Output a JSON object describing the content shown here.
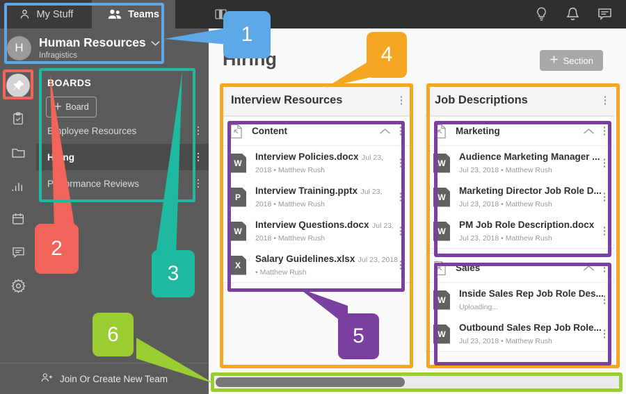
{
  "window": {
    "title": "Hiring"
  },
  "left_panel": {
    "tabs": [
      {
        "label": "My Stuff",
        "icon": "person-icon",
        "active": false
      },
      {
        "label": "Teams",
        "icon": "people-icon",
        "active": true
      }
    ],
    "team": {
      "avatar_initial": "H",
      "name": "Human Resources",
      "org": "Infragistics",
      "chevron": "chevron-down-icon"
    },
    "rail_icons": [
      "pin-icon",
      "checklist-icon",
      "folder-icon",
      "bar-chart-icon",
      "calendar-icon",
      "chat-icon",
      "settings-gear-icon"
    ],
    "boards": {
      "heading": "BOARDS",
      "add_board_label": "Board",
      "items": [
        {
          "label": "Employee Resources",
          "selected": false
        },
        {
          "label": "Hiring",
          "selected": true
        },
        {
          "label": "Performance Reviews",
          "selected": false
        }
      ]
    },
    "footer": {
      "label": "Join Or Create New Team",
      "icon": "add-people-icon"
    }
  },
  "topbar": {
    "panel_toggle_icon": "panel-toggle-icon",
    "icons": [
      "lightbulb-icon",
      "bell-icon",
      "chat-icon"
    ]
  },
  "main": {
    "page_title": "Hiring",
    "add_section_label": "Section",
    "columns": [
      {
        "title": "Interview Resources",
        "groups": [
          {
            "name": "Content",
            "collapsed": false,
            "files": [
              {
                "name": "Interview Policies.docx",
                "sub": "Jul 23, 2018 • Matthew Rush",
                "type": "W"
              },
              {
                "name": "Interview Training.pptx",
                "sub": "Jul 23, 2018 • Matthew Rush",
                "type": "P"
              },
              {
                "name": "Interview Questions.docx",
                "sub": "Jul 23, 2018 • Matthew Rush",
                "type": "W"
              },
              {
                "name": "Salary Guidelines.xlsx",
                "sub": "Jul 23, 2018 • Matthew Rush",
                "type": "X"
              }
            ]
          }
        ]
      },
      {
        "title": "Job Descriptions",
        "groups": [
          {
            "name": "Marketing",
            "collapsed": false,
            "files": [
              {
                "name": "Audience Marketing Manager ...",
                "sub": "Jul 23, 2018 • Matthew Rush",
                "type": "W"
              },
              {
                "name": "Marketing Director Job Role D...",
                "sub": "Jul 23, 2018 • Matthew Rush",
                "type": "W"
              },
              {
                "name": "PM Job Role Description.docx",
                "sub": "Jul 23, 2018 • Matthew Rush",
                "type": "W"
              }
            ]
          },
          {
            "name": "Sales",
            "collapsed": false,
            "files": [
              {
                "name": "Inside Sales Rep Job Role Des...",
                "sub": "Uploading...",
                "type": "W"
              },
              {
                "name": "Outbound Sales Rep Job Role...",
                "sub": "Jul 23, 2018 • Matthew Rush",
                "type": "W"
              }
            ]
          }
        ]
      }
    ]
  },
  "annotations": {
    "callouts": [
      {
        "number": "1",
        "color": "#5FA8E8"
      },
      {
        "number": "2",
        "color": "#F2645A"
      },
      {
        "number": "3",
        "color": "#1FB8A0"
      },
      {
        "number": "4",
        "color": "#F5A623"
      },
      {
        "number": "5",
        "color": "#7B3FA0"
      },
      {
        "number": "6",
        "color": "#9ACD32"
      }
    ],
    "highlight_colors": {
      "team_header": "#5FA8E8",
      "pin_icon": "#F2645A",
      "boards_panel": "#1FB8A0",
      "columns": "#F5A623",
      "groups": "#7B3FA0",
      "scrollbar": "#9ACD32"
    }
  }
}
